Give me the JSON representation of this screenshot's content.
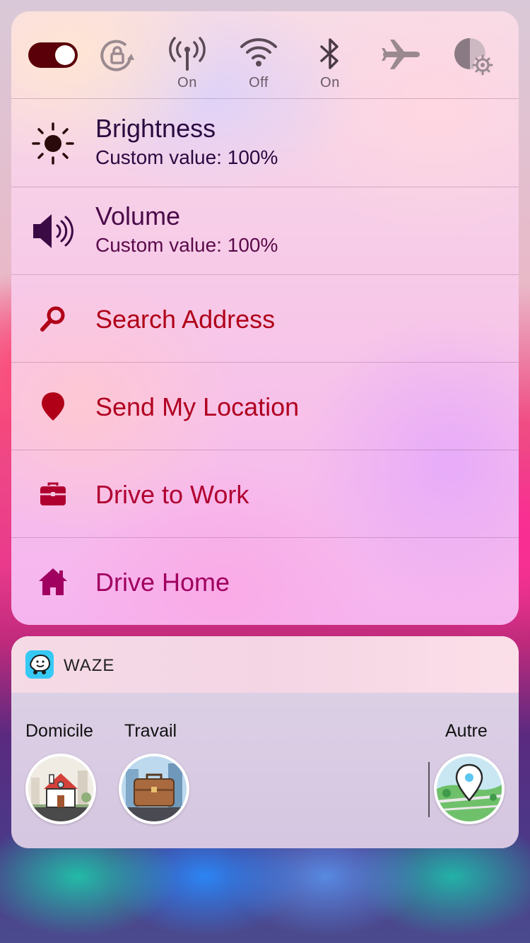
{
  "toggles": {
    "main_switch": {
      "state": "on",
      "color": "#5a0008"
    },
    "rotation_lock": {
      "icon": "rotation-lock-icon"
    },
    "cellular": {
      "icon": "cellular-antenna-icon",
      "label": "On"
    },
    "wifi": {
      "icon": "wifi-icon",
      "label": "Off"
    },
    "bluetooth": {
      "icon": "bluetooth-icon",
      "label": "On"
    },
    "airplane": {
      "icon": "airplane-icon"
    },
    "appearance": {
      "icon": "appearance-settings-icon"
    }
  },
  "menu": {
    "brightness": {
      "title": "Brightness",
      "subtitle": "Custom value: 100%",
      "icon": "sun-icon"
    },
    "volume": {
      "title": "Volume",
      "subtitle": "Custom value: 100%",
      "icon": "speaker-icon"
    },
    "search": {
      "title": "Search Address",
      "icon": "search-icon"
    },
    "send_location": {
      "title": "Send My Location",
      "icon": "location-pin-icon"
    },
    "drive_work": {
      "title": "Drive to Work",
      "icon": "briefcase-icon"
    },
    "drive_home": {
      "title": "Drive Home",
      "icon": "home-icon"
    }
  },
  "widget": {
    "app_name": "WAZE",
    "app_icon": "waze-icon",
    "places": [
      {
        "label": "Domicile",
        "icon": "house-icon"
      },
      {
        "label": "Travail",
        "icon": "briefcase-icon"
      },
      {
        "label": "Autre",
        "icon": "map-pin-icon"
      }
    ]
  },
  "colors": {
    "accent_red": "#b00018",
    "dark_text": "#2a0a40",
    "icon_gray": "#6a5a66"
  }
}
